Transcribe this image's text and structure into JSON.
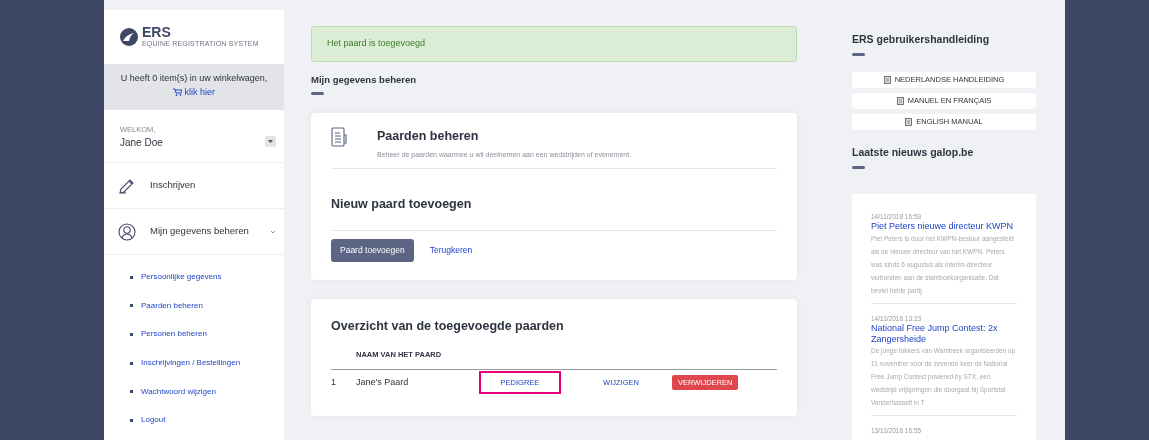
{
  "logo": {
    "title": "ERS",
    "subtitle": "EQUINE REGISTRATION SYSTEM"
  },
  "cart": {
    "message": "U heeft 0 item(s) in uw winkelwagen,",
    "link": "klik hier"
  },
  "user": {
    "welcome": "WELKOM,",
    "name": "Jane Doe"
  },
  "sidebar": {
    "items": [
      {
        "label": "Inschrijven",
        "kind": "pencil"
      },
      {
        "label": "Mijn gegevens beheren",
        "kind": "user",
        "expanded": true,
        "children": [
          {
            "label": "Persoonlijke gegevens"
          },
          {
            "label": "Paarden beheren"
          },
          {
            "label": "Personen beheren"
          },
          {
            "label": "Inschrijvingen / Bestellingen"
          },
          {
            "label": "Wachtwoord wijzigen"
          },
          {
            "label": "Logout"
          }
        ]
      }
    ]
  },
  "alert": {
    "text": "Het paard is toegevoegd"
  },
  "section_title": "Mijn gegevens beheren",
  "manage_card": {
    "title": "Paarden beheren",
    "description": "Beheer de paarden waarmee u wil deelnemen aan een wedstrijden of evenement.",
    "subtitle": "Nieuw paard toevoegen",
    "primary_button": "Paard toevoegen",
    "back_link": "Terugkeren"
  },
  "overview": {
    "title": "Overzicht van de toegevoegde paarden",
    "columns": [
      "NAAM VAN HET PAARD"
    ],
    "rows": [
      {
        "number": "1",
        "name": "Jane's Paard",
        "pedigree": "PEDIGREE",
        "pedigree_highlighted": true,
        "edit": "WIJZIGEN",
        "delete": "VERWIJDEREN"
      }
    ]
  },
  "manuals": {
    "title": "ERS gebruikershandleiding",
    "buttons": [
      "NEDERLANDSE HANDLEIDING",
      "MANUEL EN FRANÇAIS",
      "ENGLISH MANUAL"
    ]
  },
  "news": {
    "title": "Laatste nieuws galop.be",
    "items": [
      {
        "date": "14/11/2018 16:59",
        "title": "Piet Peters nieuwe directeur KWPN",
        "summary": "Piet Peters is door het KWPN-bestuur aangesteld als de nieuwe directeur van het KWPN. Peters was sinds 6 augustus als interim-directeur verbonden aan de stamboekorganisatie. Dat beviel beide partij"
      },
      {
        "date": "14/11/2018 13:23",
        "title": "National Free Jump Contest: 2x Zangersheide",
        "summary": "De jonge fokkers van Wambeek organiseerden op 11 november voor de zevende keer de National Free Jump Contest powered by STX, een wedstrijd vrijspringen die doorgaat bij Sportstal Vanderhasselt in T"
      },
      {
        "date": "13/11/2018 16:55"
      }
    ]
  }
}
